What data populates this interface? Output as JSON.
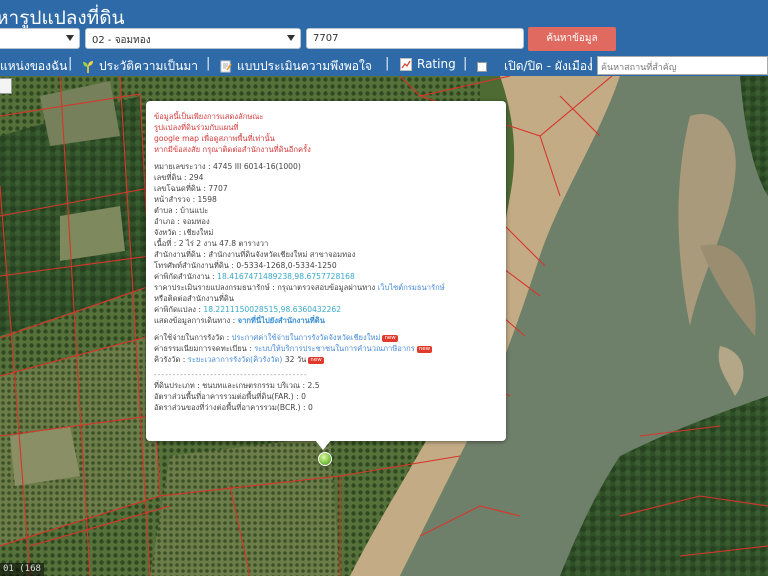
{
  "app": {
    "title": "หารูปแปลงที่ดิน"
  },
  "search": {
    "province_value": "",
    "district_value": "02 - จอมทอง",
    "parcel_value": "7707",
    "button_label": "ค้นหาข้อมูล"
  },
  "nav": {
    "item1": "แหน่งของฉัน",
    "item2": "ประวัติความเป็นมา",
    "item3": "แบบประเมินความพึงพอใจ",
    "item4": "Rating",
    "item5": "เปิด/ปิด - ผังเมือง",
    "separator": "|",
    "place_placeholder": "ค้นหาสถานที่สำคัญ"
  },
  "map": {
    "coord_readout": "01 (168"
  },
  "popup": {
    "notice": [
      "ข้อมูลนี้เป็นเพียงการแสดงลักษณะ",
      "รูปแปลงที่ดินร่วมกับแผนที่",
      "google map เพื่อดูสภาพพื้นที่เท่านั้น",
      "หากมีข้อสงสัย กรุณาติดต่อสำนักงานที่ดินอีกครั้ง"
    ],
    "map_sheet_label": "หมายเลขระวาง :",
    "map_sheet_value": "4745 III 6014-16(1000)",
    "land_no_label": "เลขที่ดิน :",
    "land_no_value": "294",
    "deed_no_label": "เลขโฉนดที่ดิน :",
    "deed_no_value": "7707",
    "survey_page_label": "หน้าสำรวจ :",
    "survey_page_value": "1598",
    "subdistrict_label": "ตำบล :",
    "subdistrict_value": "บ้านแปะ",
    "district_label": "อำเภอ :",
    "district_value": "จอมทอง",
    "province_label": "จังหวัด :",
    "province_value": "เชียงใหม่",
    "area_label": "เนื้อที่ :",
    "area_value": "2 ไร่ 2 งาน 47.8 ตารางวา",
    "office_label": "สำนักงานที่ดิน :",
    "office_value": "สำนักงานที่ดินจังหวัดเชียงใหม่ สาขาจอมทอง",
    "phone_label": "โทรศัพท์สำนักงานที่ดิน :",
    "phone_value": "0-5334-1268,0-5334-1250",
    "office_coord_label": "ค่าพิกัดสำนักงาน :",
    "office_coord_value": "18.4167471489238,98.6757728168",
    "price_label": "ราคาประเมินรายแปลงกรมธนารักษ์ :",
    "price_value": "กรุณาตรวจสอบข้อมูลผ่านทาง",
    "price_link": "เว็บไซต์กรมธนารักษ์",
    "price_suffix": "หรือติดต่อสำนักงานที่ดิน",
    "parcel_coord_label": "ค่าพิกัดแปลง :",
    "parcel_coord_value": "18.2211150028515,98.6360432262",
    "route_label": "แสดงข้อมูลการเดินทาง :",
    "route_link": "จากที่นี่ไปยังสำนักงานที่ดิน",
    "fee_label": "ค่าใช้จ่ายในการรังวัด :",
    "fee_link": "ประกาศค่าใช้จ่ายในการรังวัดจังหวัดเชียงใหม่",
    "service_label": "ค่าธรรมเนียมการจดทะเบียน :",
    "service_link": "ระบบให้บริการประชาชนในการคำนวณภาษีอากร",
    "queue_label": "คิวรังวัด :",
    "queue_link": "ระยะเวลาการรังวัด(คิวรังวัด)",
    "queue_value": "32 วัน",
    "new_badge": "new",
    "divider": "- - - - - - - - - - - - - - - - - - - - - - - - - - - - - - - - - - - - - - - - -",
    "zone_label": "ที่ดินประเภท : ชนบทและเกษตรกรรม บริเวณ :",
    "zone_value": "2.5",
    "far_label": "อัตราส่วนพื้นที่อาคารรวมต่อพื้นที่ดิน(FAR.) :",
    "far_value": "0",
    "bcr_label": "อัตราส่วนของที่ว่างต่อพื้นที่อาคารรวม(BCR.) :",
    "bcr_value": "0"
  },
  "colors": {
    "header_bg": "#2e6aa8",
    "search_button": "#e06a60",
    "notice_red": "#d33a3a",
    "link_blue": "#3b8fd1",
    "river": "#6f806a",
    "farmland": "#4d6b33"
  },
  "icons": {
    "location": "location-pin-icon",
    "history": "sprout-icon",
    "survey": "document-edit-icon",
    "rating": "chart-icon",
    "toggle": "checkbox-icon",
    "map_control": "map-control-icon",
    "marker": "parcel-marker-icon"
  }
}
